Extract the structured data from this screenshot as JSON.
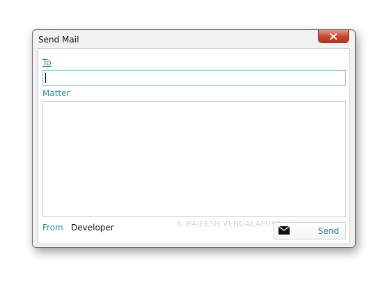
{
  "window": {
    "title": "Send Mail"
  },
  "form": {
    "to_label": "To",
    "to_value": "",
    "matter_label": "Matter",
    "matter_value": "",
    "from_label": "From",
    "from_value": "Developer",
    "send_label": "Send"
  },
  "watermark": "© RAJEESH VENGALAPURATH",
  "icons": {
    "close": "close-icon",
    "send": "envelope-icon"
  },
  "colors": {
    "accent": "#2f8d8d",
    "close_button": "#c8452e"
  }
}
